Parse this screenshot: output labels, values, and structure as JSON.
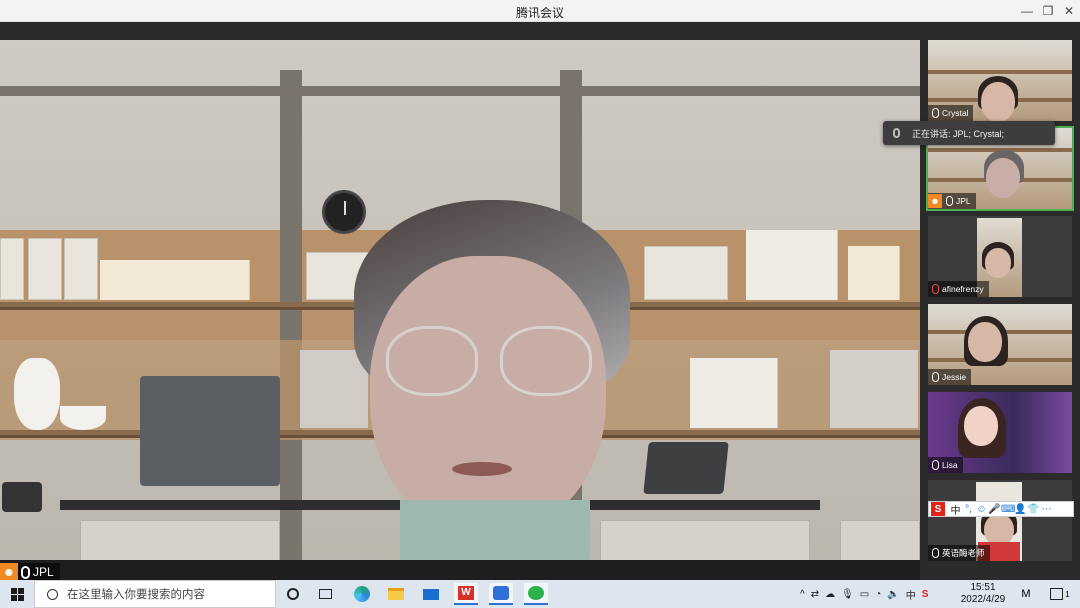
{
  "window": {
    "title": "腾讯会议",
    "minimize_glyph": "—",
    "restore_glyph": "❐",
    "close_glyph": "✕"
  },
  "main_video": {
    "speaker_name": "JPL",
    "host_badge": "host-icon"
  },
  "speaking_tooltip": {
    "text": "正在讲话: JPL; Crystal;"
  },
  "participants": [
    {
      "name": "Crystal",
      "host": false,
      "active": false
    },
    {
      "name": "JPL",
      "host": true,
      "active": true
    },
    {
      "name": "afinefrenzy",
      "host": false,
      "active": false
    },
    {
      "name": "Jessie",
      "host": false,
      "active": false
    },
    {
      "name": "Lisa",
      "host": false,
      "active": false
    },
    {
      "name": "英语酶老师",
      "host": false,
      "active": false
    }
  ],
  "ime_toolbar": {
    "logo": "S",
    "mode": "中",
    "items": [
      "°,",
      "☺",
      "🎤",
      "⌨",
      "👤",
      "👕",
      "⋯"
    ]
  },
  "taskbar": {
    "search_placeholder": "在这里输入你要搜索的内容",
    "apps": [
      "cortana-circle",
      "task-view",
      "edge",
      "file-explorer",
      "mail",
      "wps",
      "tencent-meeting",
      "wechat"
    ],
    "tray": {
      "ime_mode": "中",
      "time": "15:51",
      "date": "2022/4/29",
      "notification_count": "1"
    }
  },
  "colors": {
    "host_orange": "#f08a24",
    "active_border": "#4caf50",
    "taskbar_bg": "#dde5ef",
    "accent_blue": "#2f6fd6"
  }
}
